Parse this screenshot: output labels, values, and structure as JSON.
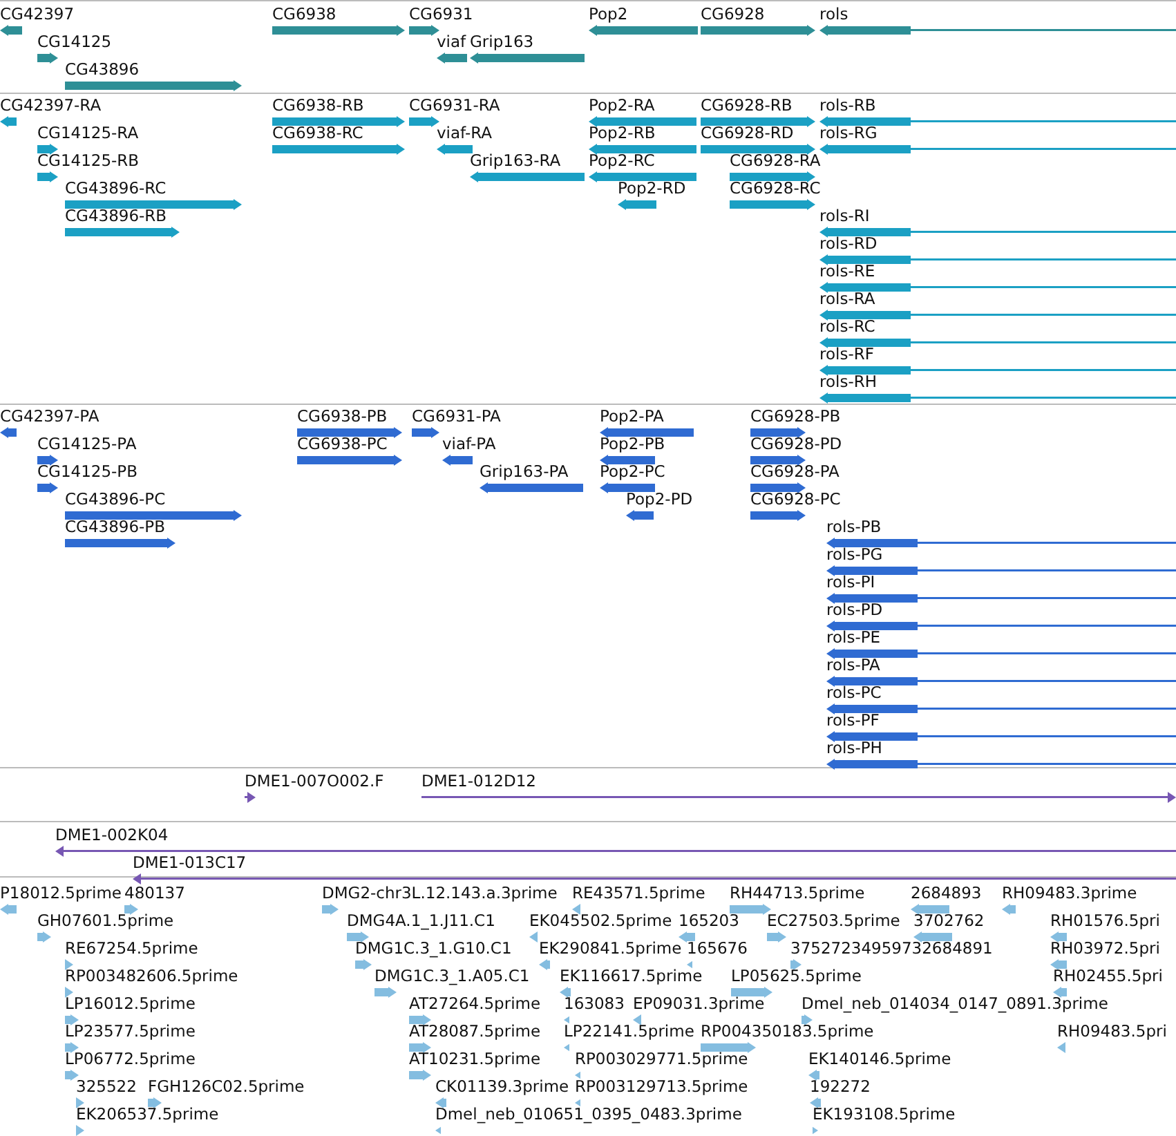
{
  "tracks": [
    {
      "kind": "genes",
      "color": "#2e8f96",
      "features": [
        {
          "label": "CG42397",
          "reverse": true
        },
        {
          "label": "CG14125",
          "reverse": false
        },
        {
          "label": "CG43896",
          "reverse": false
        },
        {
          "label": "CG6938",
          "reverse": false
        },
        {
          "label": "CG6931",
          "reverse": false
        },
        {
          "label": "viaf",
          "reverse": true
        },
        {
          "label": "Grip163",
          "reverse": true
        },
        {
          "label": "Pop2",
          "reverse": true
        },
        {
          "label": "CG6928",
          "reverse": false
        },
        {
          "label": "rols",
          "reverse": true
        }
      ]
    },
    {
      "kind": "transcripts",
      "color": "#1ba0c4",
      "features": [
        {
          "label": "CG42397-RA",
          "reverse": true
        },
        {
          "label": "CG14125-RA",
          "reverse": false
        },
        {
          "label": "CG14125-RB",
          "reverse": false
        },
        {
          "label": "CG43896-RC",
          "reverse": false
        },
        {
          "label": "CG43896-RB",
          "reverse": false
        },
        {
          "label": "CG6938-RB",
          "reverse": false
        },
        {
          "label": "CG6938-RC",
          "reverse": false
        },
        {
          "label": "CG6931-RA",
          "reverse": false
        },
        {
          "label": "viaf-RA",
          "reverse": true
        },
        {
          "label": "Grip163-RA",
          "reverse": true
        },
        {
          "label": "Pop2-RA",
          "reverse": true
        },
        {
          "label": "Pop2-RB",
          "reverse": true
        },
        {
          "label": "Pop2-RC",
          "reverse": true
        },
        {
          "label": "Pop2-RD",
          "reverse": true
        },
        {
          "label": "CG6928-RB",
          "reverse": false
        },
        {
          "label": "CG6928-RD",
          "reverse": false
        },
        {
          "label": "CG6928-RA",
          "reverse": false
        },
        {
          "label": "CG6928-RC",
          "reverse": false
        },
        {
          "label": "rols-RB",
          "reverse": true
        },
        {
          "label": "rols-RG",
          "reverse": true
        },
        {
          "label": "rols-RI",
          "reverse": true
        },
        {
          "label": "rols-RD",
          "reverse": true
        },
        {
          "label": "rols-RE",
          "reverse": true
        },
        {
          "label": "rols-RA",
          "reverse": true
        },
        {
          "label": "rols-RC",
          "reverse": true
        },
        {
          "label": "rols-RF",
          "reverse": true
        },
        {
          "label": "rols-RH",
          "reverse": true
        }
      ]
    },
    {
      "kind": "proteins",
      "color": "#2f6bd2",
      "features": [
        {
          "label": "CG42397-PA",
          "reverse": true
        },
        {
          "label": "CG14125-PA",
          "reverse": false
        },
        {
          "label": "CG14125-PB",
          "reverse": false
        },
        {
          "label": "CG43896-PC",
          "reverse": false
        },
        {
          "label": "CG43896-PB",
          "reverse": false
        },
        {
          "label": "CG6938-PB",
          "reverse": false
        },
        {
          "label": "CG6938-PC",
          "reverse": false
        },
        {
          "label": "CG6931-PA",
          "reverse": false
        },
        {
          "label": "viaf-PA",
          "reverse": true
        },
        {
          "label": "Grip163-PA",
          "reverse": true
        },
        {
          "label": "Pop2-PA",
          "reverse": true
        },
        {
          "label": "Pop2-PB",
          "reverse": true
        },
        {
          "label": "Pop2-PC",
          "reverse": true
        },
        {
          "label": "Pop2-PD",
          "reverse": true
        },
        {
          "label": "CG6928-PB",
          "reverse": false
        },
        {
          "label": "CG6928-PD",
          "reverse": false
        },
        {
          "label": "CG6928-PA",
          "reverse": false
        },
        {
          "label": "CG6928-PC",
          "reverse": false
        },
        {
          "label": "rols-PB",
          "reverse": true
        },
        {
          "label": "rols-PG",
          "reverse": true
        },
        {
          "label": "rols-PI",
          "reverse": true
        },
        {
          "label": "rols-PD",
          "reverse": true
        },
        {
          "label": "rols-PE",
          "reverse": true
        },
        {
          "label": "rols-PA",
          "reverse": true
        },
        {
          "label": "rols-PC",
          "reverse": true
        },
        {
          "label": "rols-PF",
          "reverse": true
        },
        {
          "label": "rols-PH",
          "reverse": true
        }
      ]
    },
    {
      "kind": "clones",
      "color": "#7757b3",
      "features": [
        {
          "label": "DME1-007O002.F",
          "reverse": false
        },
        {
          "label": "DME1-012D12",
          "reverse": false
        }
      ]
    },
    {
      "kind": "clones",
      "color": "#7757b3",
      "features": [
        {
          "label": "DME1-002K04",
          "reverse": true
        },
        {
          "label": "DME1-013C17",
          "reverse": true
        }
      ]
    },
    {
      "kind": "ests",
      "color": "#84bde0",
      "features": [
        {
          "label": "P18012.5prime",
          "reverse": true
        },
        {
          "label": "480137",
          "reverse": false
        },
        {
          "label": "DMG2-chr3L.12.143.a.3prime",
          "reverse": false
        },
        {
          "label": "RE43571.5prime",
          "reverse": true
        },
        {
          "label": "RH44713.5prime",
          "reverse": false
        },
        {
          "label": "2684893",
          "reverse": true
        },
        {
          "label": "RH09483.3prime",
          "reverse": true
        },
        {
          "label": "GH07601.5prime",
          "reverse": false
        },
        {
          "label": "DMG4A.1_1.J11.C1",
          "reverse": false
        },
        {
          "label": "EK045502.5prime",
          "reverse": true
        },
        {
          "label": "165203",
          "reverse": true
        },
        {
          "label": "EC27503.5prime",
          "reverse": false
        },
        {
          "label": "3702762",
          "reverse": true
        },
        {
          "label": "RH01576.5pri",
          "reverse": true
        },
        {
          "label": "RE67254.5prime",
          "reverse": false
        },
        {
          "label": "DMG1C.3_1.G10.C1",
          "reverse": false
        },
        {
          "label": "EK290841.5prime",
          "reverse": true
        },
        {
          "label": "165676",
          "reverse": true
        },
        {
          "label": "37527234959732684891",
          "reverse": false
        },
        {
          "label": "RH03972.5pri",
          "reverse": true
        },
        {
          "label": "RP003482606.5prime",
          "reverse": false
        },
        {
          "label": "DMG1C.3_1.A05.C1",
          "reverse": false
        },
        {
          "label": "EK116617.5prime",
          "reverse": true
        },
        {
          "label": "LP05625.5prime",
          "reverse": false
        },
        {
          "label": "RH02455.5pri",
          "reverse": true
        },
        {
          "label": "LP16012.5prime",
          "reverse": false
        },
        {
          "label": "AT27264.5prime",
          "reverse": false
        },
        {
          "label": "163083",
          "reverse": true
        },
        {
          "label": "EP09031.3prime",
          "reverse": true
        },
        {
          "label": "Dmel_neb_014034_0147_0891.3prime",
          "reverse": false
        },
        {
          "label": "LP23577.5prime",
          "reverse": false
        },
        {
          "label": "AT28087.5prime",
          "reverse": false
        },
        {
          "label": "LP22141.5prime",
          "reverse": true
        },
        {
          "label": "RP004350183.5prime",
          "reverse": false
        },
        {
          "label": "RH09483.5pri",
          "reverse": true
        },
        {
          "label": "LP06772.5prime",
          "reverse": false
        },
        {
          "label": "AT10231.5prime",
          "reverse": false
        },
        {
          "label": "RP003029771.5prime",
          "reverse": true
        },
        {
          "label": "EK140146.5prime",
          "reverse": true
        },
        {
          "label": "325522",
          "reverse": false
        },
        {
          "label": "FGH126C02.5prime",
          "reverse": false
        },
        {
          "label": "CK01139.3prime",
          "reverse": true
        },
        {
          "label": "RP003129713.5prime",
          "reverse": true
        },
        {
          "label": "192272",
          "reverse": true
        },
        {
          "label": "EK206537.5prime",
          "reverse": false
        },
        {
          "label": "Dmel_neb_010651_0395_0483.3prime",
          "reverse": true
        },
        {
          "label": "EK193108.5prime",
          "reverse": false
        }
      ]
    }
  ]
}
